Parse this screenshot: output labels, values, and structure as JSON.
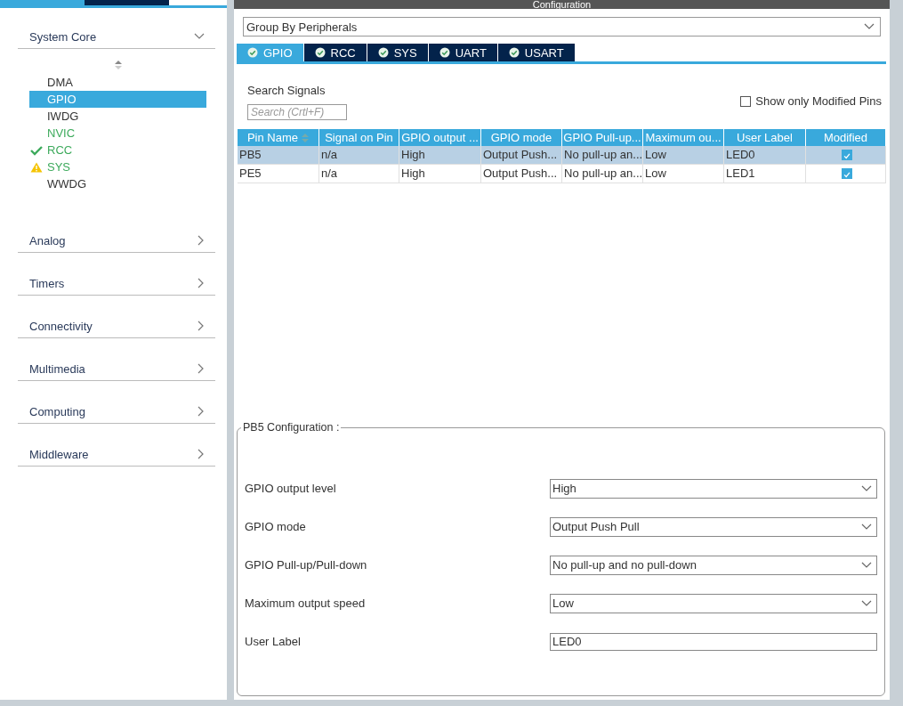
{
  "sidebar": {
    "top_tabs": [
      {
        "selected": true
      },
      {
        "selected": false
      }
    ],
    "categories": [
      {
        "label": "System Core",
        "expanded": true,
        "items": [
          {
            "label": "DMA",
            "kind": "plain",
            "selected": false
          },
          {
            "label": "GPIO",
            "kind": "plain",
            "selected": true
          },
          {
            "label": "IWDG",
            "kind": "plain",
            "selected": false
          },
          {
            "label": "NVIC",
            "kind": "enabled",
            "selected": false
          },
          {
            "label": "RCC",
            "kind": "ok",
            "selected": false
          },
          {
            "label": "SYS",
            "kind": "warning",
            "selected": false
          },
          {
            "label": "WWDG",
            "kind": "plain",
            "selected": false
          }
        ]
      },
      {
        "label": "Analog",
        "expanded": false
      },
      {
        "label": "Timers",
        "expanded": false
      },
      {
        "label": "Connectivity",
        "expanded": false
      },
      {
        "label": "Multimedia",
        "expanded": false
      },
      {
        "label": "Computing",
        "expanded": false
      },
      {
        "label": "Middleware",
        "expanded": false
      }
    ]
  },
  "panel": {
    "title": "Configuration",
    "group_by": "Group By Peripherals",
    "tabs": [
      {
        "label": "GPIO",
        "selected": true
      },
      {
        "label": "RCC",
        "selected": false
      },
      {
        "label": "SYS",
        "selected": false
      },
      {
        "label": "UART",
        "selected": false
      },
      {
        "label": "USART",
        "selected": false
      }
    ],
    "search_label": "Search Signals",
    "search": {
      "placeholder": "Search (Crtl+F)"
    },
    "show_modified": {
      "label": "Show only Modified Pins",
      "checked": false
    },
    "table": {
      "columns": [
        "Pin Name",
        "Signal on Pin",
        "GPIO output ...",
        "GPIO mode",
        "GPIO Pull-up...",
        "Maximum ou...",
        "User Label",
        "Modified"
      ],
      "rows": [
        {
          "cells": [
            "PB5",
            "n/a",
            "High",
            "Output Push...",
            "No pull-up an...",
            "Low",
            "LED0"
          ],
          "modified": true,
          "selected": true
        },
        {
          "cells": [
            "PE5",
            "n/a",
            "High",
            "Output Push...",
            "No pull-up an...",
            "Low",
            "LED1"
          ],
          "modified": true,
          "selected": false
        }
      ]
    },
    "config": {
      "title": "PB5 Configuration :",
      "fields": [
        {
          "label": "GPIO output level",
          "kind": "select",
          "value": "High"
        },
        {
          "label": "GPIO mode",
          "kind": "select",
          "value": "Output Push Pull"
        },
        {
          "label": "GPIO Pull-up/Pull-down",
          "kind": "select",
          "value": "No pull-up and no pull-down"
        },
        {
          "label": "Maximum output speed",
          "kind": "select",
          "value": "Low"
        },
        {
          "label": "User Label",
          "kind": "text",
          "value": "LED0"
        }
      ]
    }
  }
}
